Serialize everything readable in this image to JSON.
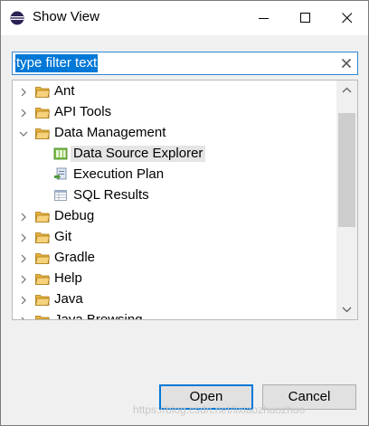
{
  "window": {
    "title": "Show View",
    "icon": "eclipse-icon",
    "controls": {
      "minimize": "minimize-icon",
      "maximize": "maximize-icon",
      "close": "close-icon"
    }
  },
  "filter": {
    "value": "type filter text",
    "placeholder": "type filter text",
    "clear_icon": "clear-icon"
  },
  "tree": {
    "items": [
      {
        "label": "Ant",
        "icon": "folder-icon",
        "expanded": false
      },
      {
        "label": "API Tools",
        "icon": "folder-icon",
        "expanded": false
      },
      {
        "label": "Data Management",
        "icon": "folder-icon",
        "expanded": true
      },
      {
        "label": "Data Source Explorer",
        "icon": "data-source-explorer-icon",
        "selected": true
      },
      {
        "label": "Execution Plan",
        "icon": "execution-plan-icon"
      },
      {
        "label": "SQL Results",
        "icon": "sql-results-icon"
      },
      {
        "label": "Debug",
        "icon": "folder-icon",
        "expanded": false
      },
      {
        "label": "Git",
        "icon": "folder-icon",
        "expanded": false
      },
      {
        "label": "Gradle",
        "icon": "folder-icon",
        "expanded": false
      },
      {
        "label": "Help",
        "icon": "folder-icon",
        "expanded": false
      },
      {
        "label": "Java",
        "icon": "folder-icon",
        "expanded": false
      },
      {
        "label": "Java Browsing",
        "icon": "folder-icon",
        "expanded": false
      }
    ]
  },
  "buttons": {
    "open": "Open",
    "cancel": "Cancel"
  },
  "watermark": "https://blog.csdn.net/lixiaozhuozhuo",
  "colors": {
    "selection": "#0078d7",
    "folder": "#e8b23d",
    "default_button_border": "#0078d7"
  }
}
